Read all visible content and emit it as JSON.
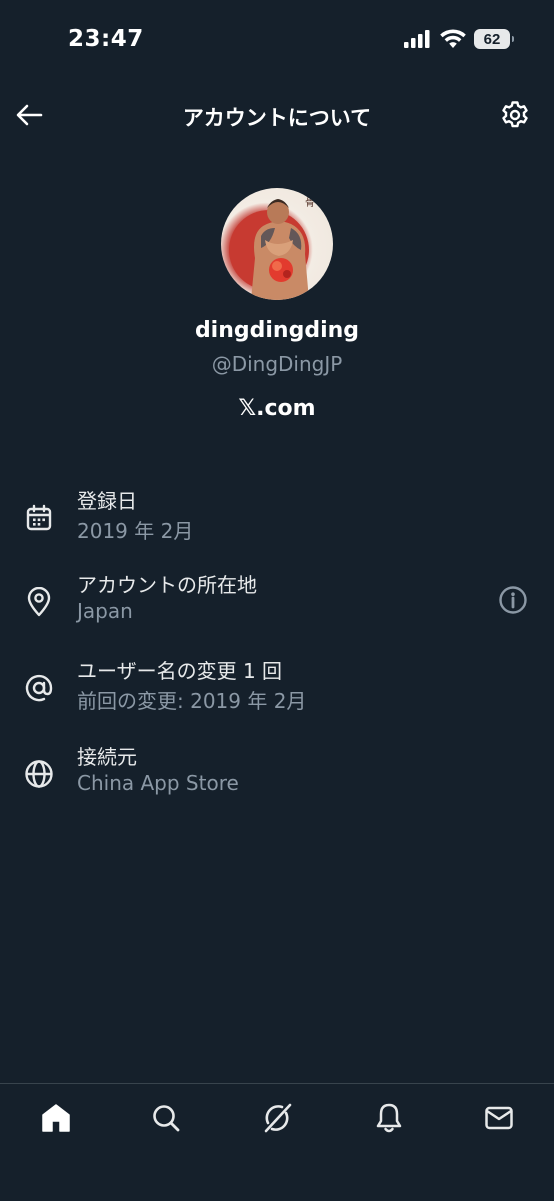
{
  "status_bar": {
    "time": "23:47",
    "battery": "62"
  },
  "header": {
    "title": "アカウントについて"
  },
  "profile": {
    "name": "dingdingding",
    "handle": "@DingDingJP",
    "site": "𝕏.com"
  },
  "info": [
    {
      "icon": "calendar-icon",
      "label": "登録日",
      "value": "2019 年 2月"
    },
    {
      "icon": "location-pin-icon",
      "label": "アカウントの所在地",
      "value": "Japan"
    },
    {
      "icon": "at-sign-icon",
      "label": "ユーザー名の変更 1 回",
      "value": "前回の変更: 2019 年 2月"
    },
    {
      "icon": "globe-icon",
      "label": "接続元",
      "value": "China App Store"
    }
  ],
  "tab_bar": {
    "tabs": [
      "home",
      "search",
      "grok",
      "notifications",
      "messages"
    ],
    "active": "home"
  },
  "colors": {
    "background": "#15202b",
    "text_primary": "#e7e9ea",
    "text_secondary": "#8b98a5",
    "divider": "#38444d"
  }
}
